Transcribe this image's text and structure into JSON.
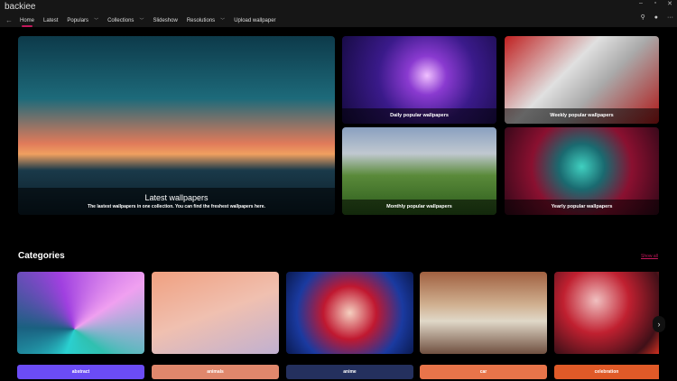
{
  "app": {
    "title": "backiee"
  },
  "nav": {
    "items": [
      {
        "label": "Home",
        "active": true
      },
      {
        "label": "Latest"
      },
      {
        "label": "Populars",
        "dropdown": true
      },
      {
        "label": "Collections",
        "dropdown": true
      },
      {
        "label": "Slideshow"
      },
      {
        "label": "Resolutions",
        "dropdown": true
      },
      {
        "label": "Upload wallpaper"
      }
    ]
  },
  "hero": {
    "title": "Latest wallpapers",
    "subtitle": "The lastest wallpapers in one collection. You can find the freshest wallpapers here."
  },
  "tiles": [
    {
      "label": "Daily popular wallpapers"
    },
    {
      "label": "Weekly popular wallpapers"
    },
    {
      "label": "Monthly popular wallpapers"
    },
    {
      "label": "Yearly popular wallpapers"
    }
  ],
  "categories": {
    "title": "Categories",
    "show_all": "Show all",
    "items": [
      {
        "label": "abstract",
        "color": "#6b4cf5"
      },
      {
        "label": "animals",
        "color": "#e0876c"
      },
      {
        "label": "anime",
        "color": "#24305e"
      },
      {
        "label": "car",
        "color": "#e8744a"
      },
      {
        "label": "celebration",
        "color": "#e05a28"
      }
    ]
  }
}
